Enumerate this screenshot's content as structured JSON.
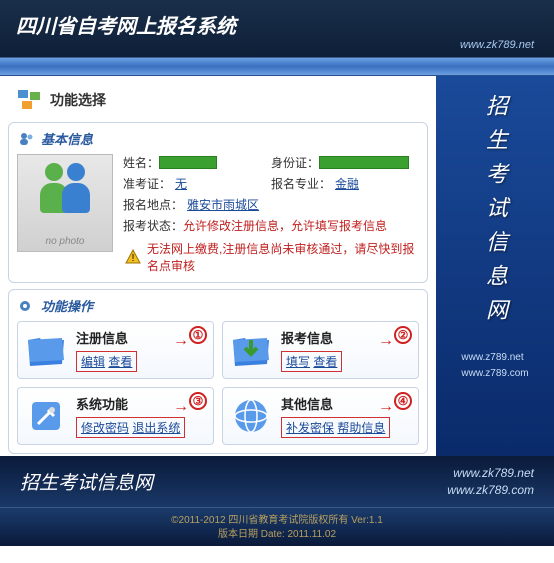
{
  "header": {
    "title": "四川省自考网上报名系统",
    "url": "www.zk789.net"
  },
  "panel": {
    "title": "功能选择"
  },
  "basic": {
    "section_title": "基本信息",
    "photo_placeholder": "no photo",
    "fields": {
      "name_lbl": "姓名：",
      "id_lbl": "身份证：",
      "ticket_lbl": "准考证：",
      "ticket_val": "无",
      "major_lbl": "报名专业：",
      "major_val": "金融",
      "location_lbl": "报名地点：",
      "location_val": "雅安市雨城区",
      "status_lbl": "报考状态：",
      "status_val": "允许修改注册信息，允许填写报考信息"
    },
    "warning": "无法网上缴费,注册信息尚未审核通过，请尽快到报名点审核"
  },
  "func": {
    "section_title": "功能操作",
    "cards": [
      {
        "title": "注册信息",
        "links": [
          {
            "t": "编辑"
          },
          {
            "t": "查看"
          }
        ],
        "num": "①"
      },
      {
        "title": "报考信息",
        "links": [
          {
            "t": "填写"
          },
          {
            "t": "查看"
          }
        ],
        "num": "②"
      },
      {
        "title": "系统功能",
        "links": [
          {
            "t": "修改密码"
          },
          {
            "t": "退出系统"
          }
        ],
        "num": "③"
      },
      {
        "title": "其他信息",
        "links": [
          {
            "t": "补发密保"
          },
          {
            "t": "帮助信息"
          }
        ],
        "num": "④"
      }
    ]
  },
  "sidebar": {
    "title": "招生考试信息网",
    "urls": [
      "www.z789.net",
      "www.z789.com"
    ]
  },
  "footer": {
    "title": "招生考试信息网",
    "urls": [
      "www.zk789.net",
      "www.zk789.com"
    ],
    "copyright1": "©2011-2012 四川省教育考试院版权所有 Ver:1.1",
    "copyright2": "版本日期 Date: 2011.11.02"
  }
}
